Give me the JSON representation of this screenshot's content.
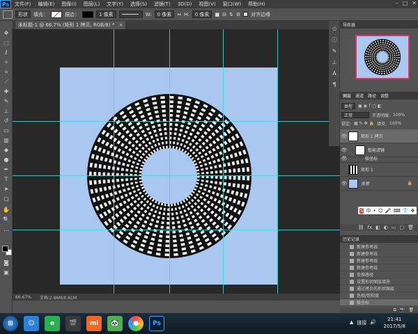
{
  "menu": {
    "logo": "Ps",
    "items": [
      "文件(F)",
      "编辑(E)",
      "图像(I)",
      "图层(L)",
      "文字(Y)",
      "选择(S)",
      "滤镜(T)",
      "3D(D)",
      "视图(V)",
      "窗口(W)",
      "帮助(H)"
    ]
  },
  "window_controls": [
    "–",
    "□",
    "✕"
  ],
  "options": {
    "mode": "形状",
    "fill_label": "填充：",
    "stroke_label": "描边：",
    "stroke_width": "1 像素",
    "w_label": "W:",
    "w_value": "0 像素",
    "h_label": "H:",
    "h_value": "0 像素",
    "align_edges": "对齐边缘"
  },
  "doc_tab": {
    "label": "未标题-1 @ 66.7% (矩形 1 拷贝, RGB/8) *",
    "close": "×"
  },
  "status": {
    "zoom": "66.67%",
    "doc": "文档:2.86M/8.81M"
  },
  "navigator": {
    "title": "导航器"
  },
  "layers_panel": {
    "tabs": [
      "图层",
      "通道",
      "路径",
      "调整"
    ],
    "kind_label": "类型",
    "blend_mode": "正常",
    "opacity_label": "不透明度:",
    "opacity_value": "100%",
    "lock_label": "锁定:",
    "fill_label": "填充:",
    "fill_value": "100%",
    "layers": [
      {
        "name": "矩形 1 拷贝",
        "visible": true
      },
      {
        "name": "智能滤镜",
        "visible": true
      },
      {
        "name": "极坐标",
        "visible": true
      },
      {
        "name": "矩形 1",
        "visible": false
      },
      {
        "name": "背景",
        "visible": true
      }
    ]
  },
  "history_panel": {
    "title": "历史记录",
    "items": [
      "新建参考线",
      "新建参考线",
      "新建参考线",
      "新建参考线",
      "变换路径",
      "设置形状图层填充",
      "通过拷贝的形状图层",
      "色相/饱和度",
      "极坐标"
    ]
  },
  "ime_bar": {
    "items": [
      "S",
      "中",
      "•",
      "☺",
      "🎤",
      "⌨",
      "👕",
      "✥"
    ]
  },
  "taskbar": {
    "apps": [
      "⊞",
      "☺",
      "e",
      "🎬",
      "mi",
      "🐼",
      "●",
      "Ps"
    ],
    "tray_lang": "链接",
    "time": "21:41",
    "date": "2017/5/8"
  },
  "colors": {
    "canvas_bg": "#a9c7ef",
    "guide": "#3fd8e0",
    "ps_blue": "#31a8ff"
  }
}
